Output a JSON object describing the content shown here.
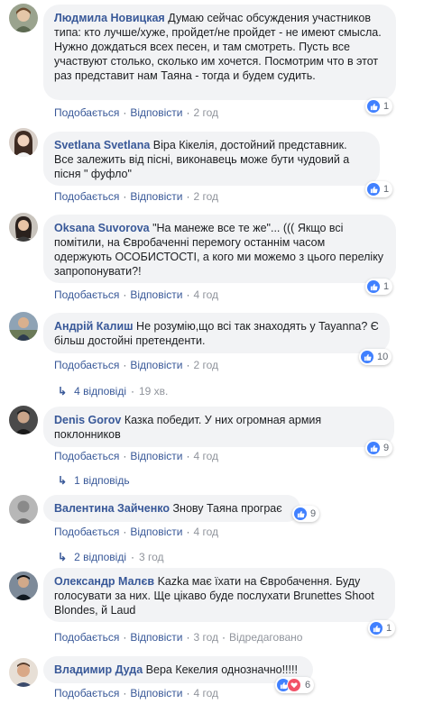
{
  "comments": [
    {
      "author": "Людмила Новицкая",
      "text": "Думаю сейчас обсуждения участников типа: кто лучше/хуже, пройдет/не пройдет - не имеют смысла. Нужно дождаться всех песен, и там смотреть. Пусть все участвуют столько, сколько им хочется. Посмотрим что в этот раз представит нам Таяна - тогда и будем судить.",
      "like": "Подобається",
      "reply": "Відповісти",
      "time": "2 год",
      "reactions": "1"
    },
    {
      "author": "Svetlana Svetlana",
      "text": "Віра Кікелія, достойний представник. Все залежить від пісні, виконавець може бути чудовий а пісня \" фуфло\"",
      "like": "Подобається",
      "reply": "Відповісти",
      "time": "2 год",
      "reactions": "1"
    },
    {
      "author": "Oksana Suvorova",
      "text": "\"На манеже все те же\"... ((( Якщо всі помітили, на Євробаченні перемогу останнім часом одержують ОСОБИСТОСТІ, а кого ми можемо з цього переліку запропонувати?!",
      "like": "Подобається",
      "reply": "Відповісти",
      "time": "4 год",
      "reactions": "1"
    },
    {
      "author": "Андрій Калиш",
      "text": "Не розумію,що всі так знаходять у Tayanna? Є більш достойні претенденти.",
      "like": "Подобається",
      "reply": "Відповісти",
      "time": "2 год",
      "reactions": "10",
      "replies": "4 відповіді",
      "replies_time": "19 хв."
    },
    {
      "author": "Denis Gorov",
      "text": "Казка победит. У них огромная армия поклонников",
      "like": "Подобається",
      "reply": "Відповісти",
      "time": "4 год",
      "reactions": "9",
      "replies": "1 відповідь"
    },
    {
      "author": "Валентина Зайченко",
      "text": "Знову Таяна програє",
      "like": "Подобається",
      "reply": "Відповісти",
      "time": "4 год",
      "reactions": "9",
      "replies": "2 відповіді",
      "replies_time": "3 год"
    },
    {
      "author": "Олександр Малєв",
      "text": "Kazka має їхати на Євробачення. Буду голосувати за них. Ще цікаво буде послухати Brunettes Shoot Blondes, й Laud",
      "like": "Подобається",
      "reply": "Відповісти",
      "time": "3 год",
      "edited": "Відредаговано",
      "reactions": "1"
    },
    {
      "author": "Владимир Дуда",
      "text": "Вера Кекелия однозначно!!!!!",
      "like": "Подобається",
      "reply": "Відповісти",
      "time": "4 год",
      "reactions": "6"
    }
  ],
  "colors": {
    "link": "#385898",
    "bubble": "#f2f3f5",
    "like": "#4080ff",
    "love": "#f25268",
    "muted": "#90949c"
  },
  "icons": [
    "avatar",
    "like-icon",
    "love-icon",
    "reply-arrow-icon"
  ]
}
